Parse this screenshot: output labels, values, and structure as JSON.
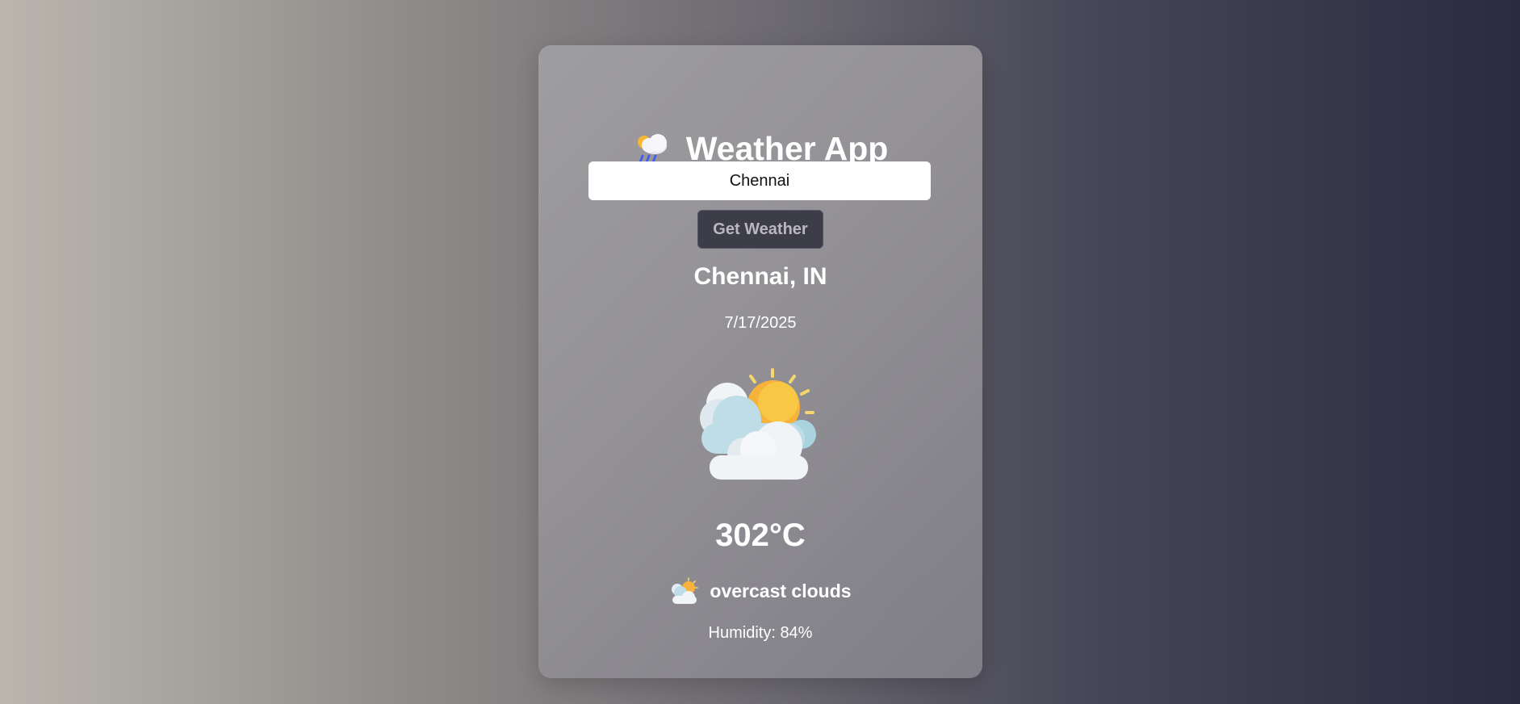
{
  "app": {
    "title": "Weather App",
    "title_icon": "cloud-sun-rain-icon"
  },
  "search": {
    "value": "Chennai"
  },
  "button": {
    "label": "Get Weather"
  },
  "weather": {
    "location": "Chennai, IN",
    "date": "7/17/2025",
    "main_icon": "partly-cloudy-icon",
    "temperature": "302°C",
    "description_icon": "partly-cloudy-small-icon",
    "description": "overcast clouds",
    "humidity": "Humidity: 84%"
  },
  "colors": {
    "card_bg": "#939195",
    "button_bg": "#3d3c49",
    "text": "#ffffff"
  }
}
